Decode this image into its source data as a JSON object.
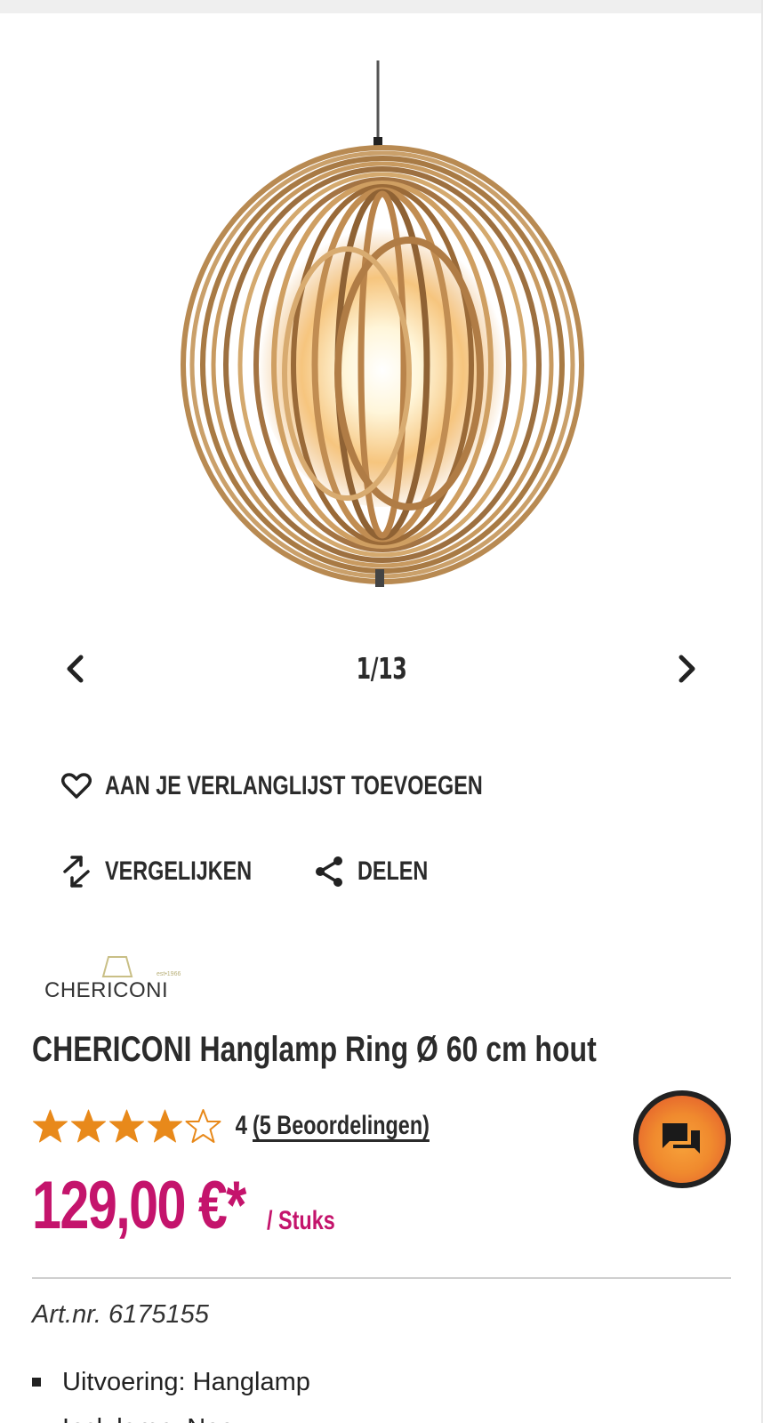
{
  "gallery": {
    "counter": "1/13",
    "prev_icon": "chevron-left-icon",
    "next_icon": "chevron-right-icon"
  },
  "actions": {
    "wishlist_label": "AAN JE VERLANGLIJST TOEVOEGEN",
    "compare_label": "VERGELIJKEN",
    "share_label": "DELEN"
  },
  "brand": {
    "name": "CHERICONI",
    "tagline": "est•1966"
  },
  "product": {
    "title": "CHERICONI Hanglamp Ring Ø 60 cm hout",
    "rating_value": "4",
    "rating_stars": 4,
    "rating_max": 5,
    "reviews_link": "(5 Beoordelingen)",
    "price": "129,00 €*",
    "price_unit": "/ Stuks",
    "art_nr": "Art.nr. 6175155",
    "features": [
      "Uitvoering: Hanglamp",
      "Incl. lamp: Nee"
    ]
  },
  "colors": {
    "accent_price": "#c4146c",
    "star": "#e8891a",
    "text": "#2b2b2b",
    "chat_gradient_start": "#f7a23a",
    "chat_gradient_end": "#e0512c"
  }
}
